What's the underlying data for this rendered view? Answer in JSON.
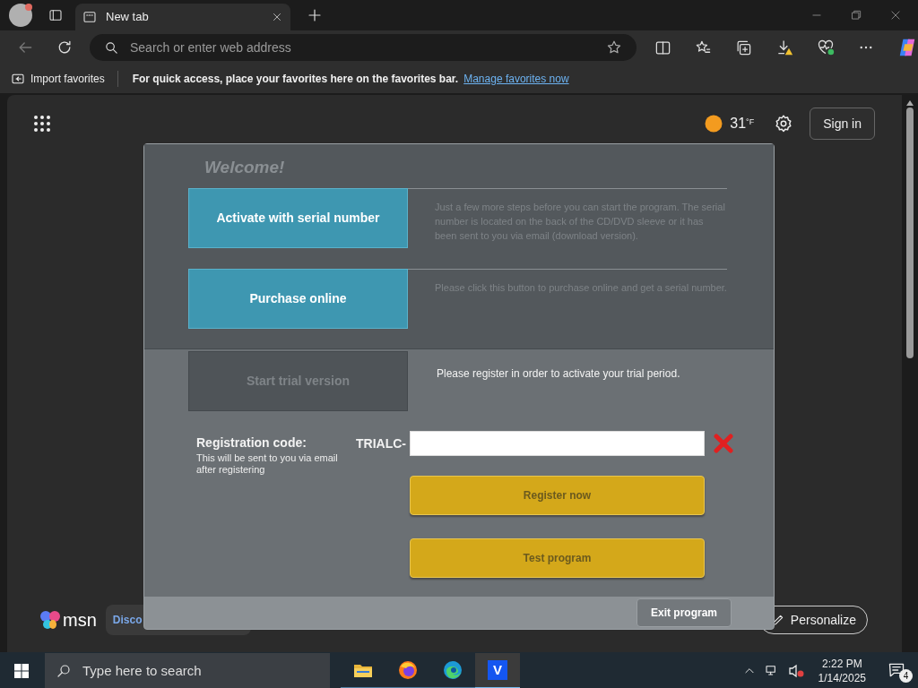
{
  "browser": {
    "tabs": [
      {
        "title": "New tab",
        "selected": true
      }
    ],
    "address_placeholder": "Search or enter web address",
    "favorites_bar": {
      "import": "Import favorites",
      "message": "For quick access, place your favorites here on the favorites bar.",
      "link": "Manage favorites now"
    }
  },
  "msn_header": {
    "temperature": "31",
    "unit": "°F",
    "sign_in": "Sign in"
  },
  "dialog": {
    "title": "Welcome!",
    "options": [
      {
        "label": "Activate with serial number",
        "description": "Just a few more steps before you can start the program. The serial number is located on the back of the CD/DVD sleeve or it has been sent to you via email (download version).",
        "disabled": false
      },
      {
        "label": "Purchase online",
        "description": "Please click this button to purchase online and get a serial number.",
        "disabled": false
      },
      {
        "label": "Start trial version",
        "description": "Please register in order to activate your trial period.",
        "disabled": true
      }
    ],
    "registration": {
      "label": "Registration code:",
      "hint": "This will be sent to you via email after registering",
      "prefix": "TRIALC-"
    },
    "actions": [
      "Register now",
      "Test program"
    ],
    "exit": "Exit program"
  },
  "msn_footer": {
    "logo": "msn",
    "chip": "Disco",
    "personalize": "Personalize"
  },
  "taskbar": {
    "search_placeholder": "Type here to search",
    "apps": [
      {
        "kind": "files",
        "selected": false
      },
      {
        "kind": "firefox",
        "selected": false
      },
      {
        "kind": "edge",
        "selected": false
      },
      {
        "kind": "v",
        "label": "V",
        "selected": true
      }
    ],
    "time": "2:22 PM",
    "date": "1/14/2025",
    "notifications": "4"
  }
}
